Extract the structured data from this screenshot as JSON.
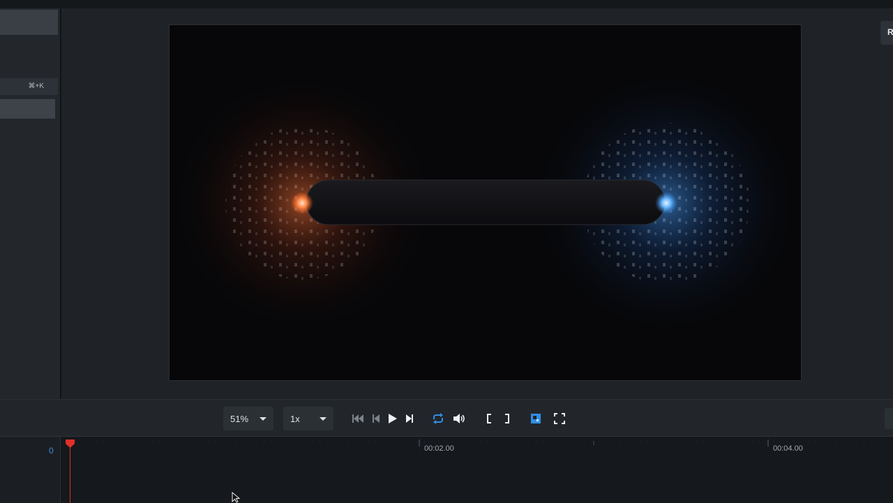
{
  "sidebar": {
    "shortcut_label": "⌘+K"
  },
  "right_panel": {
    "button_label": "R"
  },
  "controls": {
    "zoom_value": "51%",
    "speed_value": "1x",
    "icons": [
      "skip-to-start-icon",
      "step-back-icon",
      "play-icon",
      "step-forward-icon",
      "loop-icon",
      "volume-icon",
      "mark-in-icon",
      "mark-out-icon",
      "safe-area-icon",
      "fullscreen-icon"
    ],
    "accent_color": "#2f8fe6"
  },
  "timeline": {
    "track_start_label": "0",
    "ruler_labels": [
      "00:02.00",
      "00:04.00"
    ],
    "playhead_color": "#e0302b"
  },
  "preview": {
    "orb_left_color": "#ff7a3c",
    "orb_right_color": "#4aa3ff"
  }
}
